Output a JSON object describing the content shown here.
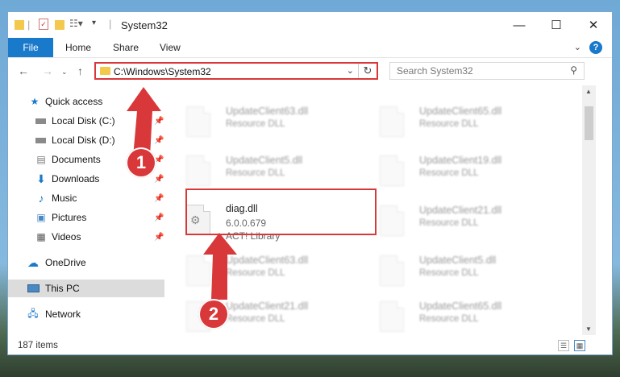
{
  "window": {
    "title": "System32"
  },
  "ribbon": {
    "file": "File",
    "tabs": [
      "Home",
      "Share",
      "View"
    ]
  },
  "nav": {
    "address": "C:\\Windows\\System32",
    "search_placeholder": "Search System32"
  },
  "sidebar": {
    "items": [
      {
        "label": "Quick access"
      },
      {
        "label": "Local Disk (C:)"
      },
      {
        "label": "Local Disk (D:)"
      },
      {
        "label": "Documents"
      },
      {
        "label": "Downloads"
      },
      {
        "label": "Music"
      },
      {
        "label": "Pictures"
      },
      {
        "label": "Videos"
      },
      {
        "label": "OneDrive"
      },
      {
        "label": "This PC"
      },
      {
        "label": "Network"
      }
    ]
  },
  "files": {
    "left": [
      {
        "name": "UpdateClient63.dll",
        "type": "Resource DLL"
      },
      {
        "name": "UpdateClient5.dll",
        "type": "Resource DLL"
      },
      {
        "name": "UpdateClient63.dll",
        "type": "Resource DLL"
      },
      {
        "name": "UpdateClient21.dll",
        "type": "Resource DLL"
      }
    ],
    "right": [
      {
        "name": "UpdateClient65.dll",
        "type": "Resource DLL"
      },
      {
        "name": "UpdateClient19.dll",
        "type": "Resource DLL"
      },
      {
        "name": "UpdateClient21.dll",
        "type": "Resource DLL"
      },
      {
        "name": "UpdateClient5.dll",
        "type": "Resource DLL"
      },
      {
        "name": "UpdateClient65.dll",
        "type": "Resource DLL"
      }
    ],
    "focus": {
      "name": "diag.dll",
      "version": "6.0.0.679",
      "description": "ACT! Library"
    }
  },
  "status": {
    "items": "187 items"
  },
  "annotations": {
    "badge1": "1",
    "badge2": "2",
    "color": "#d9383a"
  }
}
